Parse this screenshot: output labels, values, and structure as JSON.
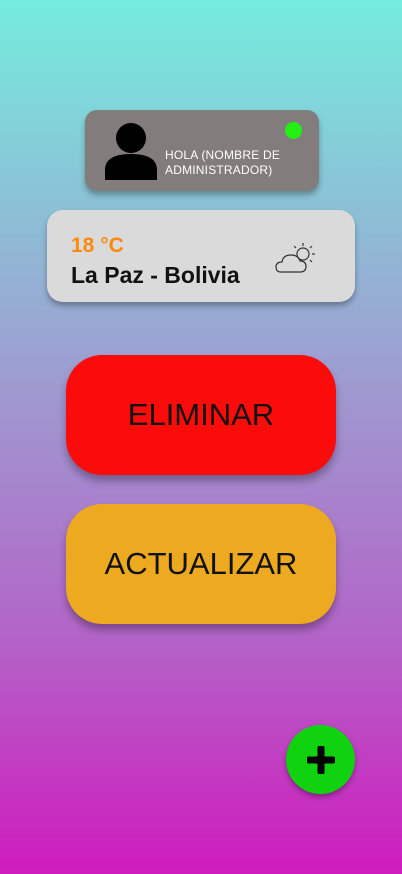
{
  "user_card": {
    "greeting": "HOLA (NOMBRE DE ADMINISTRADOR)",
    "avatar_icon": "person-icon",
    "status_color": "#22ef12"
  },
  "weather": {
    "temperature": "18 °C",
    "location": "La Paz - Bolivia",
    "icon": "partly-cloudy-icon"
  },
  "actions": {
    "delete_label": "ELIMINAR",
    "delete_color": "#fc0b0b",
    "update_label": "ACTUALIZAR",
    "update_color": "#eda91f"
  },
  "fab": {
    "icon": "plus-icon",
    "color": "#10d20f"
  }
}
